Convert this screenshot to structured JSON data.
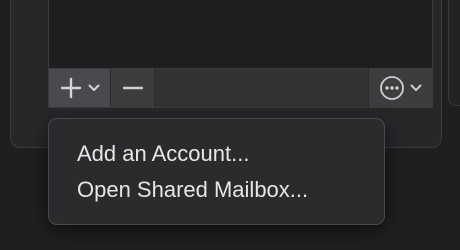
{
  "toolbar": {
    "add_icon": "plus-icon",
    "add_dropdown_icon": "chevron-down-icon",
    "remove_icon": "minus-icon",
    "action_icon": "ellipsis-circle-icon",
    "action_dropdown_icon": "chevron-down-icon"
  },
  "menu": {
    "items": [
      {
        "label": "Add an Account..."
      },
      {
        "label": "Open Shared Mailbox..."
      }
    ]
  },
  "colors": {
    "background": "#1f1f21",
    "menu_background": "#2b2b2e",
    "menu_text": "#e6e6e8",
    "toolbar_active": "#4a4a4e"
  }
}
